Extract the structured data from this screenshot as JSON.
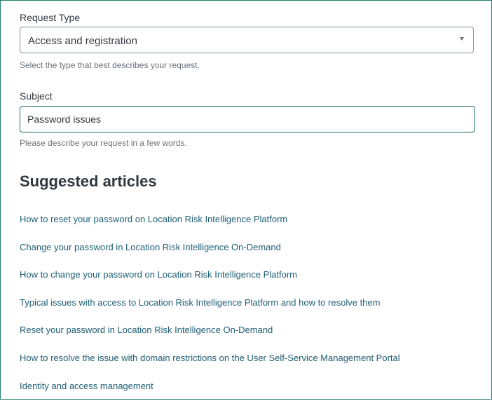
{
  "form": {
    "request_type": {
      "label": "Request Type",
      "value": "Access and registration",
      "hint": "Select the type that best describes your request."
    },
    "subject": {
      "label": "Subject",
      "value": "Password issues",
      "hint": "Please describe your request in a few words."
    }
  },
  "suggested": {
    "title": "Suggested articles",
    "articles": [
      "How to reset your password on Location Risk Intelligence Platform",
      "Change your password in Location Risk Intelligence On-Demand",
      "How to change your password on Location Risk Intelligence Platform",
      "Typical issues with access to Location Risk Intelligence Platform and how to resolve them",
      "Reset your password in Location Risk Intelligence On-Demand",
      "How to resolve the issue with domain restrictions on the User Self-Service Management Portal",
      "Identity and access management"
    ]
  },
  "colors": {
    "frame_border": "#1f7a6e",
    "link": "#1f5e74",
    "focus_border": "#1f6e67"
  }
}
